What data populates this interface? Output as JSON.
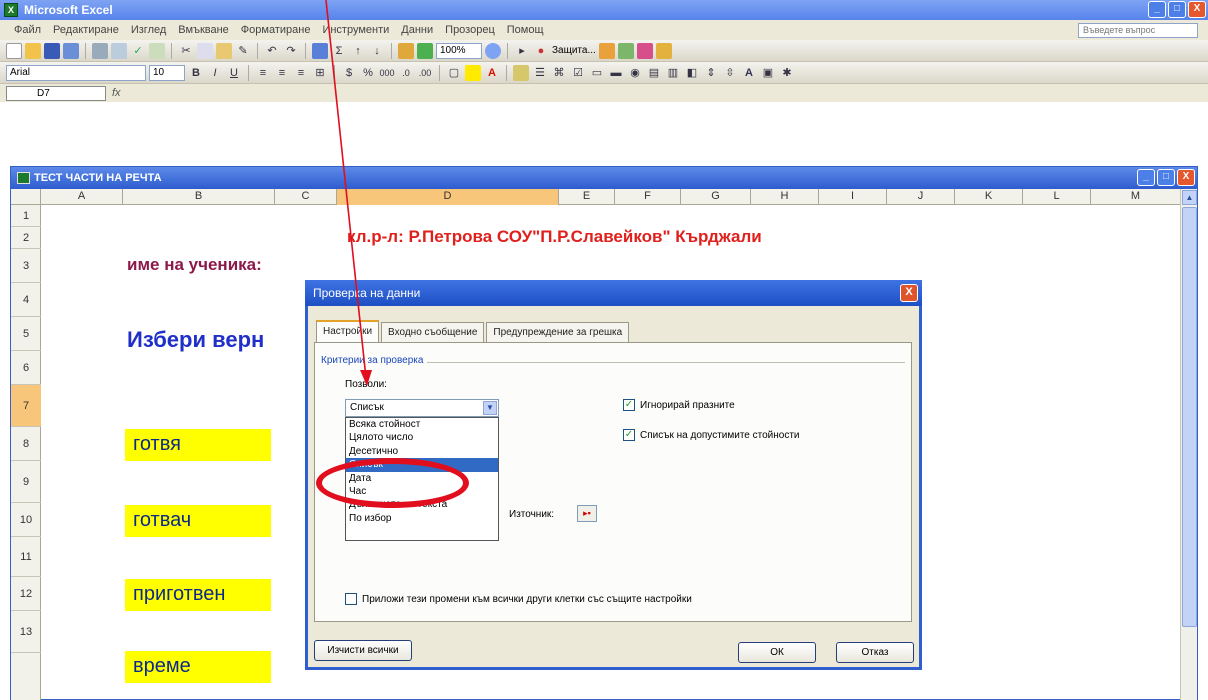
{
  "app": {
    "title": "Microsoft Excel",
    "window_buttons": [
      "_",
      "□",
      "X"
    ]
  },
  "menu": {
    "items": [
      "Файл",
      "Редактиране",
      "Изглед",
      "Вмъкване",
      "Форматиране",
      "Инструменти",
      "Данни",
      "Прозорец",
      "Помощ"
    ],
    "help_placeholder": "Въведете въпрос"
  },
  "toolbar": {
    "zoom": "100%",
    "protect_label": "Защита...",
    "font_name": "Arial",
    "font_size": "10"
  },
  "formula_bar": {
    "name_box": "D7",
    "fx": "fx"
  },
  "workbook": {
    "title": "ТЕСТ ЧАСТИ НА РЕЧТА",
    "columns": [
      "A",
      "B",
      "C",
      "D",
      "E",
      "F",
      "G",
      "H",
      "I",
      "J",
      "K",
      "L",
      "M"
    ],
    "active_column": "D",
    "rows": [
      "1",
      "2",
      "3",
      "4",
      "5",
      "6",
      "7",
      "8",
      "9",
      "10",
      "11",
      "12",
      "13"
    ],
    "active_row": "7",
    "author_line": "кл.р-л: Р.Петрова СОУ\"П.Р.Славейков\" Кърджали",
    "student_label": "име на ученика:",
    "instruction": "Избери верн",
    "words": [
      "готвя",
      "готвач",
      "приготвен",
      "време"
    ]
  },
  "dialog": {
    "title": "Проверка на данни",
    "close": "X",
    "tabs": [
      "Настройки",
      "Входно съобщение",
      "Предупреждение за грешка"
    ],
    "active_tab": "Настройки",
    "criteria_label": "Критерии за проверка",
    "allow_label": "Позволи:",
    "allow_value": "Списък",
    "dropdown_items": [
      "Всяка стойност",
      "Цялото число",
      "Десетично",
      "Списък",
      "Дата",
      "Час",
      "Дължината на текста",
      "По избор"
    ],
    "selected_item": "Списък",
    "ignore_blank": "Игнорирай празните",
    "in_cell_dropdown": "Списък на допустимите стойности",
    "source_label": "Източник:",
    "apply_all": "Приложи тези промени към всички други клетки със същите настройки",
    "clear_all": "Изчисти всички",
    "ok": "ОК",
    "cancel": "Отказ"
  }
}
